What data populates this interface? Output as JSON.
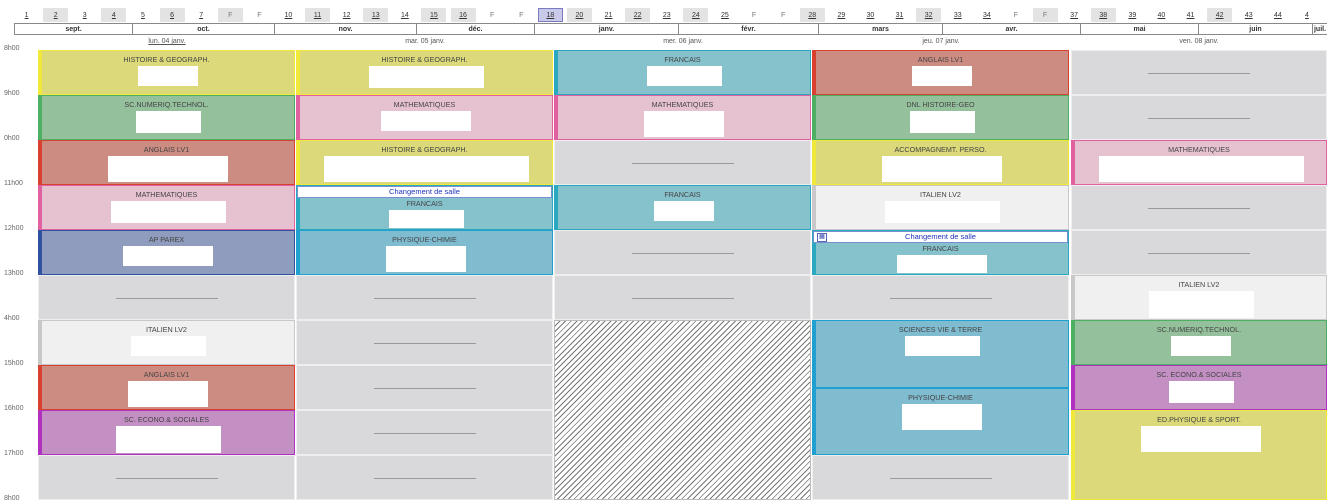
{
  "weeks": [
    {
      "label": "1"
    },
    {
      "label": "2"
    },
    {
      "label": "3"
    },
    {
      "label": "4"
    },
    {
      "label": "5"
    },
    {
      "label": "6"
    },
    {
      "label": "7"
    },
    {
      "label": "F"
    },
    {
      "label": "F"
    },
    {
      "label": "10"
    },
    {
      "label": "11"
    },
    {
      "label": "12"
    },
    {
      "label": "13"
    },
    {
      "label": "14"
    },
    {
      "label": "15"
    },
    {
      "label": "16"
    },
    {
      "label": "F"
    },
    {
      "label": "F"
    },
    {
      "label": "18"
    },
    {
      "label": "20"
    },
    {
      "label": "21"
    },
    {
      "label": "22"
    },
    {
      "label": "23"
    },
    {
      "label": "24"
    },
    {
      "label": "25"
    },
    {
      "label": "F"
    },
    {
      "label": "F"
    },
    {
      "label": "28"
    },
    {
      "label": "29"
    },
    {
      "label": "30"
    },
    {
      "label": "31"
    },
    {
      "label": "32"
    },
    {
      "label": "33"
    },
    {
      "label": "34"
    },
    {
      "label": "F"
    },
    {
      "label": "F"
    },
    {
      "label": "37"
    },
    {
      "label": "38"
    },
    {
      "label": "39"
    },
    {
      "label": "40"
    },
    {
      "label": "41"
    },
    {
      "label": "42"
    },
    {
      "label": "43"
    },
    {
      "label": "44"
    },
    {
      "label": "4"
    }
  ],
  "months": [
    "sept.",
    "oct.",
    "nov.",
    "déc.",
    "janv.",
    "févr.",
    "mars",
    "avr.",
    "mai",
    "juin",
    "juil."
  ],
  "days": [
    "lun. 04 janv.",
    "mar. 05 janv.",
    "mer. 06 janv.",
    "jeu. 07 janv.",
    "ven. 08 janv."
  ],
  "hours": [
    "8h00",
    "9h00",
    "0h00",
    "11h00",
    "12h00",
    "13h00",
    "4h00",
    "15h00",
    "16h00",
    "17h00",
    "8h00"
  ],
  "change_label": "Changement de salle",
  "schedule": [
    [
      {
        "name": "HISTOIRE & GEOGRAPH.",
        "color": "#dcd97a",
        "accent": "#f0e83a",
        "rows": 1
      },
      {
        "name": "SC.NUMERIQ.TECHNOL.",
        "color": "#94c09c",
        "accent": "#4caf62",
        "rows": 1
      },
      {
        "name": "ANGLAIS LV1",
        "color": "#cc8c82",
        "accent": "#d84030",
        "rows": 1
      },
      {
        "name": "MATHEMATIQUES",
        "color": "#e6c2d0",
        "accent": "#e060a0",
        "rows": 1
      },
      {
        "name": "AP PAREX",
        "color": "#8f9cbd",
        "accent": "#3050a0",
        "rows": 1
      },
      {
        "empty": true,
        "rows": 1
      },
      {
        "name": "ITALIEN LV2",
        "color": "#f0f0f0",
        "accent": "#c8c8c8",
        "rows": 1
      },
      {
        "name": "ANGLAIS LV1",
        "color": "#cc8c82",
        "accent": "#d84030",
        "rows": 1
      },
      {
        "name": "SC. ECONO.& SOCIALES",
        "color": "#c490c4",
        "accent": "#b030c0",
        "rows": 1
      },
      {
        "empty": true,
        "rows": 1
      }
    ],
    [
      {
        "name": "HISTOIRE & GEOGRAPH.",
        "color": "#dcd97a",
        "accent": "#f0e83a",
        "rows": 1
      },
      {
        "name": "MATHEMATIQUES",
        "color": "#e6c2d0",
        "accent": "#e060a0",
        "rows": 1
      },
      {
        "name": "HISTOIRE & GEOGRAPH.",
        "color": "#dcd97a",
        "accent": "#f0e83a",
        "rows": 1
      },
      {
        "name": "FRANCAIS",
        "color": "#86c2cc",
        "accent": "#2aa8c0",
        "rows": 1,
        "change": true
      },
      {
        "name": "PHYSIQUE-CHIMIE",
        "color": "#80bcd0",
        "accent": "#20a0d0",
        "rows": 1
      },
      {
        "empty": true,
        "rows": 1
      },
      {
        "empty": true,
        "rows": 1
      },
      {
        "empty": true,
        "rows": 1
      },
      {
        "empty": true,
        "rows": 1
      },
      {
        "empty": true,
        "rows": 1
      }
    ],
    [
      {
        "name": "FRANCAIS",
        "color": "#86c2cc",
        "accent": "#2aa8c0",
        "rows": 1
      },
      {
        "name": "MATHEMATIQUES",
        "color": "#e6c2d0",
        "accent": "#e060a0",
        "rows": 1
      },
      {
        "empty": true,
        "rows": 1
      },
      {
        "name": "FRANCAIS",
        "color": "#86c2cc",
        "accent": "#2aa8c0",
        "rows": 1
      },
      {
        "empty": true,
        "rows": 1
      },
      {
        "empty": true,
        "rows": 1
      },
      {
        "hatch": true,
        "rows": 4
      }
    ],
    [
      {
        "name": "ANGLAIS LV1",
        "color": "#cc8c82",
        "accent": "#d84030",
        "rows": 1
      },
      {
        "name": "DNL HISTOIRE-GEO",
        "color": "#94c09c",
        "accent": "#4caf62",
        "rows": 1
      },
      {
        "name": "ACCOMPAGNEMT. PERSO.",
        "color": "#dcd97a",
        "accent": "#f0e83a",
        "rows": 1
      },
      {
        "name": "ITALIEN LV2",
        "color": "#f0f0f0",
        "accent": "#c8c8c8",
        "rows": 1
      },
      {
        "name": "FRANCAIS",
        "color": "#86c2cc",
        "accent": "#2aa8c0",
        "rows": 1,
        "change": true
      },
      {
        "empty": true,
        "rows": 1
      },
      {
        "name": "SCIENCES VIE & TERRE",
        "color": "#80bcd0",
        "accent": "#20a0d0",
        "rows": 1.5
      },
      {
        "name": "PHYSIQUE-CHIMIE",
        "color": "#80bcd0",
        "accent": "#20a0d0",
        "rows": 1.5
      },
      {
        "empty": true,
        "rows": 1
      }
    ],
    [
      {
        "empty": true,
        "rows": 1
      },
      {
        "empty": true,
        "rows": 1
      },
      {
        "name": "MATHEMATIQUES",
        "color": "#e6c2d0",
        "accent": "#e060a0",
        "rows": 1
      },
      {
        "empty": true,
        "rows": 1
      },
      {
        "empty": true,
        "rows": 1
      },
      {
        "name": "ITALIEN LV2",
        "color": "#f0f0f0",
        "accent": "#c8c8c8",
        "rows": 1
      },
      {
        "name": "SC.NUMERIQ.TECHNOL.",
        "color": "#94c09c",
        "accent": "#4caf62",
        "rows": 1
      },
      {
        "name": "SC. ECONO.& SOCIALES",
        "color": "#c490c4",
        "accent": "#b030c0",
        "rows": 1
      },
      {
        "name": "ED.PHYSIQUE & SPORT.",
        "color": "#dcd97a",
        "accent": "#f0e83a",
        "rows": 2
      }
    ]
  ]
}
